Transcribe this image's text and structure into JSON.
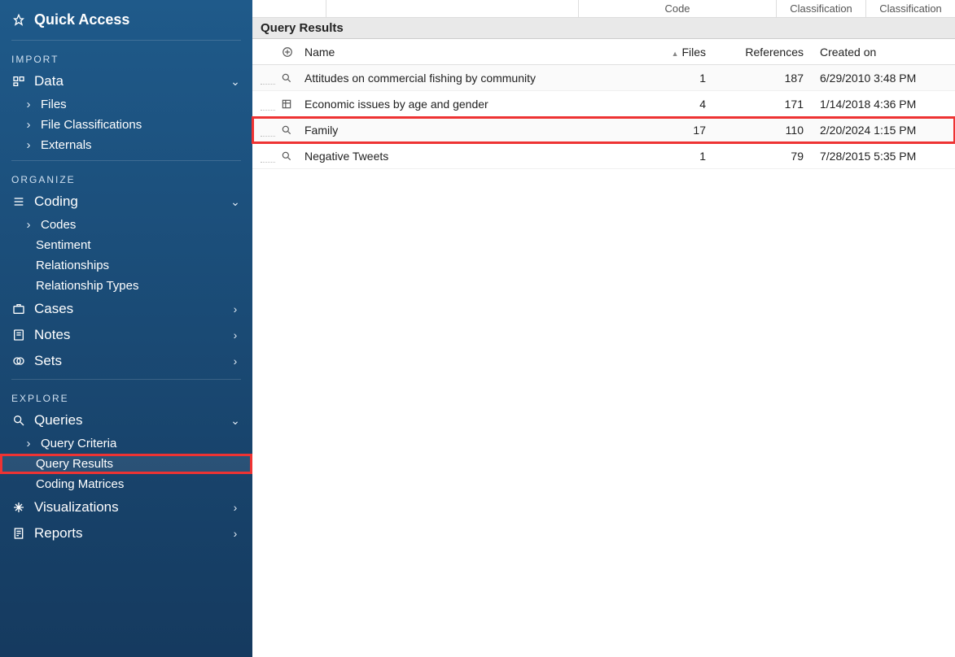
{
  "sidebar": {
    "quick_access": "Quick Access",
    "sections": {
      "import": "IMPORT",
      "organize": "ORGANIZE",
      "explore": "EXPLORE"
    },
    "data": {
      "label": "Data",
      "items": [
        "Files",
        "File Classifications",
        "Externals"
      ]
    },
    "coding": {
      "label": "Coding",
      "items": [
        "Codes",
        "Sentiment",
        "Relationships",
        "Relationship Types"
      ]
    },
    "cases": "Cases",
    "notes": "Notes",
    "sets": "Sets",
    "queries": {
      "label": "Queries",
      "items": [
        "Query Criteria",
        "Query Results",
        "Coding Matrices"
      ]
    },
    "visualizations": "Visualizations",
    "reports": "Reports"
  },
  "topHeaders": {
    "code": "Code",
    "class1": "Classification",
    "class2": "Classification"
  },
  "queryResults": {
    "title": "Query Results",
    "columns": {
      "name": "Name",
      "files": "Files",
      "references": "References",
      "created": "Created on"
    },
    "rows": [
      {
        "name": "Attitudes on commercial fishing by community",
        "files": "1",
        "refs": "187",
        "date": "6/29/2010 3:48 PM"
      },
      {
        "name": "Economic issues by age and gender",
        "files": "4",
        "refs": "171",
        "date": "1/14/2018 4:36 PM"
      },
      {
        "name": "Family",
        "files": "17",
        "refs": "110",
        "date": "2/20/2024 1:15 PM"
      },
      {
        "name": "Negative Tweets",
        "files": "1",
        "refs": "79",
        "date": "7/28/2015 5:35 PM"
      }
    ]
  }
}
